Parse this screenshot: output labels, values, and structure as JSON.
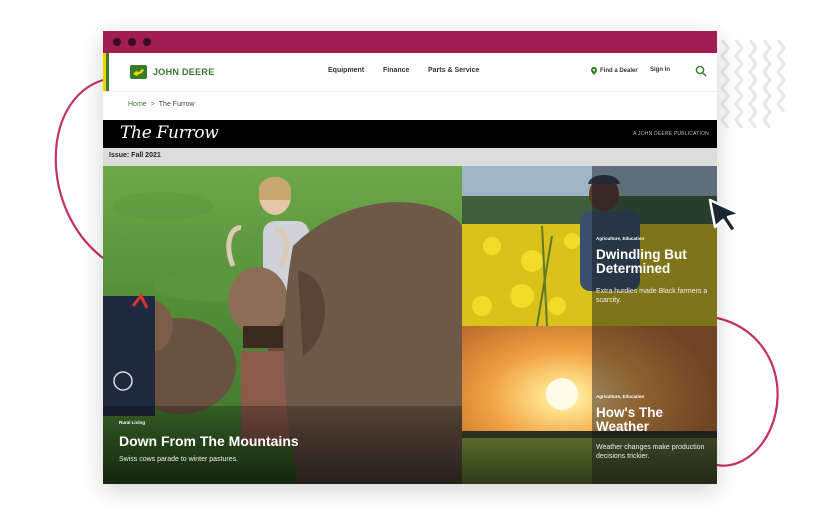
{
  "colors": {
    "accent": "#a11d52",
    "brand_green": "#367c2b",
    "brand_yellow": "#f4d300",
    "deco_line": "#c2335f"
  },
  "header": {
    "brand": "JOHN DEERE",
    "logo_icon": "deer-logo-icon",
    "nav": [
      "Equipment",
      "Finance",
      "Parts & Service"
    ],
    "find_dealer": "Find a Dealer",
    "sign_in": "Sign In",
    "search_icon": "search-icon"
  },
  "breadcrumb": {
    "home": "Home",
    "separator": ">",
    "current": "The Furrow"
  },
  "furrow": {
    "title": "The Furrow",
    "tagline": "A JOHN DEERE PUBLICATION"
  },
  "issue": "Issue: Fall 2021",
  "stories": {
    "main": {
      "category": "Rural Living",
      "headline": "Down From The Mountains",
      "summary": "Swiss cows parade to winter pastures."
    },
    "top": {
      "category": "Agriculture, Education",
      "headline": "Dwindling But Determined",
      "summary": "Extra hurdles made Black farmers a scarcity."
    },
    "bottom": {
      "category": "Agriculture, Education",
      "headline": "How's The Weather",
      "summary": "Weather changes make production decisions trickier."
    }
  }
}
